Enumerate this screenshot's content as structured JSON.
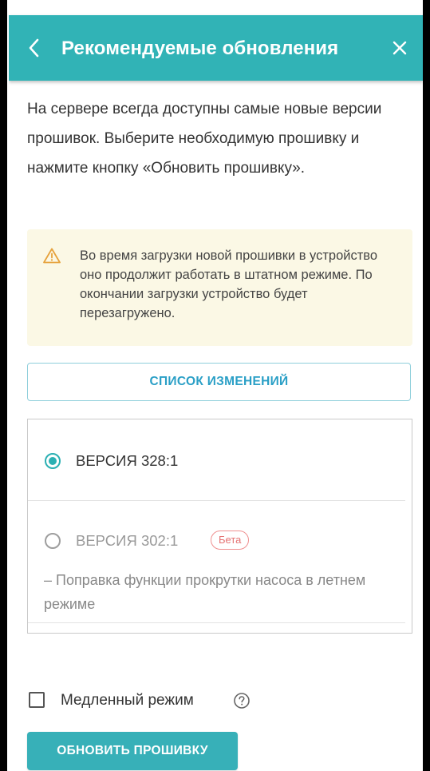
{
  "header": {
    "title": "Рекомендуемые обновления",
    "back_icon": "chevron-left-icon",
    "close_icon": "close-icon",
    "background_color": "#31b3b6"
  },
  "intro_text": "На сервере всегда доступны самые новые версии прошивок. Выберите необходимую прошивку и нажмите кнопку «Обновить прошивку».",
  "warning": {
    "icon": "warning-triangle-icon",
    "text": "Во время загрузки новой прошивки в устройство оно продолжит работать в штатном режиме. По окончании загрузки устройство будет перезагружено.",
    "background_color": "#fbf8e5"
  },
  "changes_button_label": "СПИСОК ИЗМЕНЕНИЙ",
  "versions": [
    {
      "label": "ВЕРСИЯ 328:1",
      "selected": true
    },
    {
      "label": "ВЕРСИЯ 302:1",
      "selected": false,
      "badge": "Бета",
      "description": "– Поправка функции прокрутки насоса в летнем режиме"
    }
  ],
  "slow_mode": {
    "label": "Медленный режим",
    "checked": false,
    "help_icon": "help-circle-icon"
  },
  "update_button_label": "ОБНОВИТЬ ПРОШИВКУ",
  "colors": {
    "accent": "#2bb0b3",
    "link": "#2a9fc6",
    "beta": "#e57373"
  }
}
